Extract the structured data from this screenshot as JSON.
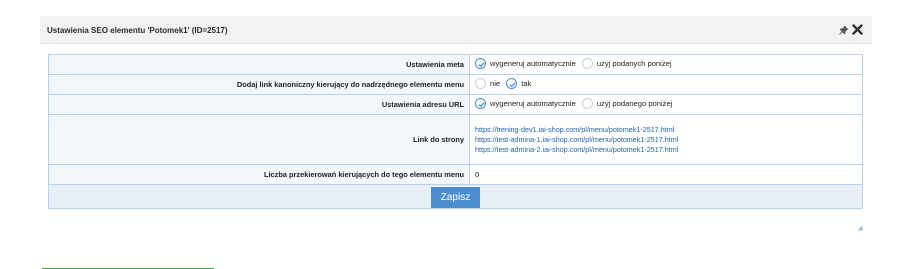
{
  "dialog": {
    "title": "Ustawienia SEO elementu 'Potomek1' (ID=2517)",
    "icons": [
      "pin-icon",
      "close-icon"
    ]
  },
  "rows": {
    "meta": {
      "label": "Ustawienia meta",
      "options": [
        {
          "label": "wygeneruj automatycznie",
          "checked": true
        },
        {
          "label": "użyj podanych poniżej",
          "checked": false
        }
      ]
    },
    "canonical": {
      "label": "Dodaj link kanoniczny kierujący do nadrzędnego elementu menu",
      "options": [
        {
          "label": "nie",
          "checked": false
        },
        {
          "label": "tak",
          "checked": true
        }
      ]
    },
    "url": {
      "label": "Ustawienia adresu URL",
      "options": [
        {
          "label": "wygeneruj automatycznie",
          "checked": true
        },
        {
          "label": "użyj podanego poniżej",
          "checked": false
        }
      ]
    },
    "link": {
      "label": "Link do strony",
      "links": [
        "https://trening-dev1.iai-shop.com/pl/menu/potomek1-2517.html",
        "https://test-admina-1.iai-shop.com/pl/menu/potomek1-2517.html",
        "https://test-admina-2.iai-shop.com/pl/menu/potomek1-2517.html"
      ]
    },
    "redirects": {
      "label": "Liczba przekierowań kierujących do tego elementu menu",
      "value": "0"
    }
  },
  "save_label": "Zapisz",
  "colors": {
    "accent": "#4b8fd2",
    "border": "#b9d3ea",
    "link": "#1f62b0",
    "label_bg": "#f3f6fa"
  }
}
